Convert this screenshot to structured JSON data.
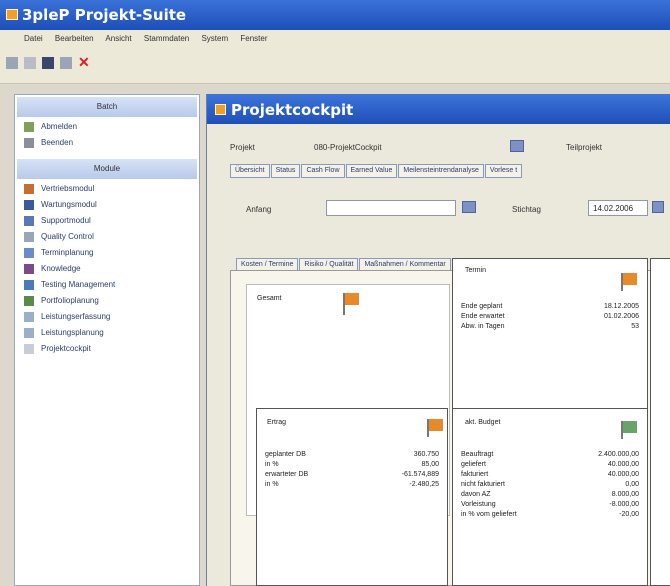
{
  "app": {
    "title": "3pleP Projekt-Suite"
  },
  "menu": [
    "Datei",
    "Bearbeiten",
    "Ansicht",
    "Stammdaten",
    "System",
    "Fenster"
  ],
  "sidebar": {
    "section_batch": "Batch",
    "batch_items": [
      "Abmelden",
      "Beenden"
    ],
    "section_module": "Module",
    "module_items": [
      "Vertriebsmodul",
      "Wartungsmodul",
      "Supportmodul",
      "Quality Control",
      "Terminplanung",
      "Knowledge",
      "Testing Management",
      "Portfolioplanung",
      "Leistungserfassung",
      "Leistungsplanung",
      "Projektcockpit"
    ]
  },
  "cockpit": {
    "title": "Projektcockpit",
    "projekt_label": "Projekt",
    "projekt_value": "080-ProjektCockpit",
    "teilprojekt_label": "Teilprojekt",
    "tabs": [
      "Übersicht",
      "Status",
      "Cash Flow",
      "Earned Value",
      "Meilensteintrendanalyse",
      "Vorlese t"
    ],
    "anfang_label": "Anfang",
    "stichtag_label": "Stichtag",
    "stichtag_value": "14.02.2006",
    "subtabs": [
      "Kosten / Termine",
      "Risiko / Qualität",
      "Maßnahmen / Kommentar"
    ]
  },
  "cards": {
    "gesamt": {
      "title": "Gesamt",
      "flag_color": "#e88a2a"
    },
    "termin": {
      "title": "Termin",
      "flag_color": "#e88a2a",
      "rows": [
        {
          "label": "Ende geplant",
          "value": "18.12.2005"
        },
        {
          "label": "Ende erwartet",
          "value": "01.02.2006"
        },
        {
          "label": "Abw. in Tagen",
          "value": "53"
        }
      ]
    },
    "ertrag": {
      "title": "Ertrag",
      "flag_color": "#e88a2a",
      "rows": [
        {
          "label": "geplanter DB",
          "value": "360.750"
        },
        {
          "label": "in %",
          "value": "85,00"
        },
        {
          "label": "erwarteter DB",
          "value": "-61.574,889"
        },
        {
          "label": "in %",
          "value": "-2.480,25"
        }
      ]
    },
    "budget": {
      "title": "akt. Budget",
      "flag_color": "#6aa36a",
      "rows": [
        {
          "label": "Beauftragt",
          "value": "2.400.000,00"
        },
        {
          "label": "geliefert",
          "value": "40.000,00"
        },
        {
          "label": "fakturiert",
          "value": "40.000,00"
        },
        {
          "label": "nicht fakturiert",
          "value": "0,00"
        },
        {
          "label": "davon AZ",
          "value": "8.000,00"
        },
        {
          "label": "Vorleistung",
          "value": "-8.000,00"
        },
        {
          "label": "in % vom geliefert",
          "value": "-20,00"
        }
      ]
    }
  }
}
